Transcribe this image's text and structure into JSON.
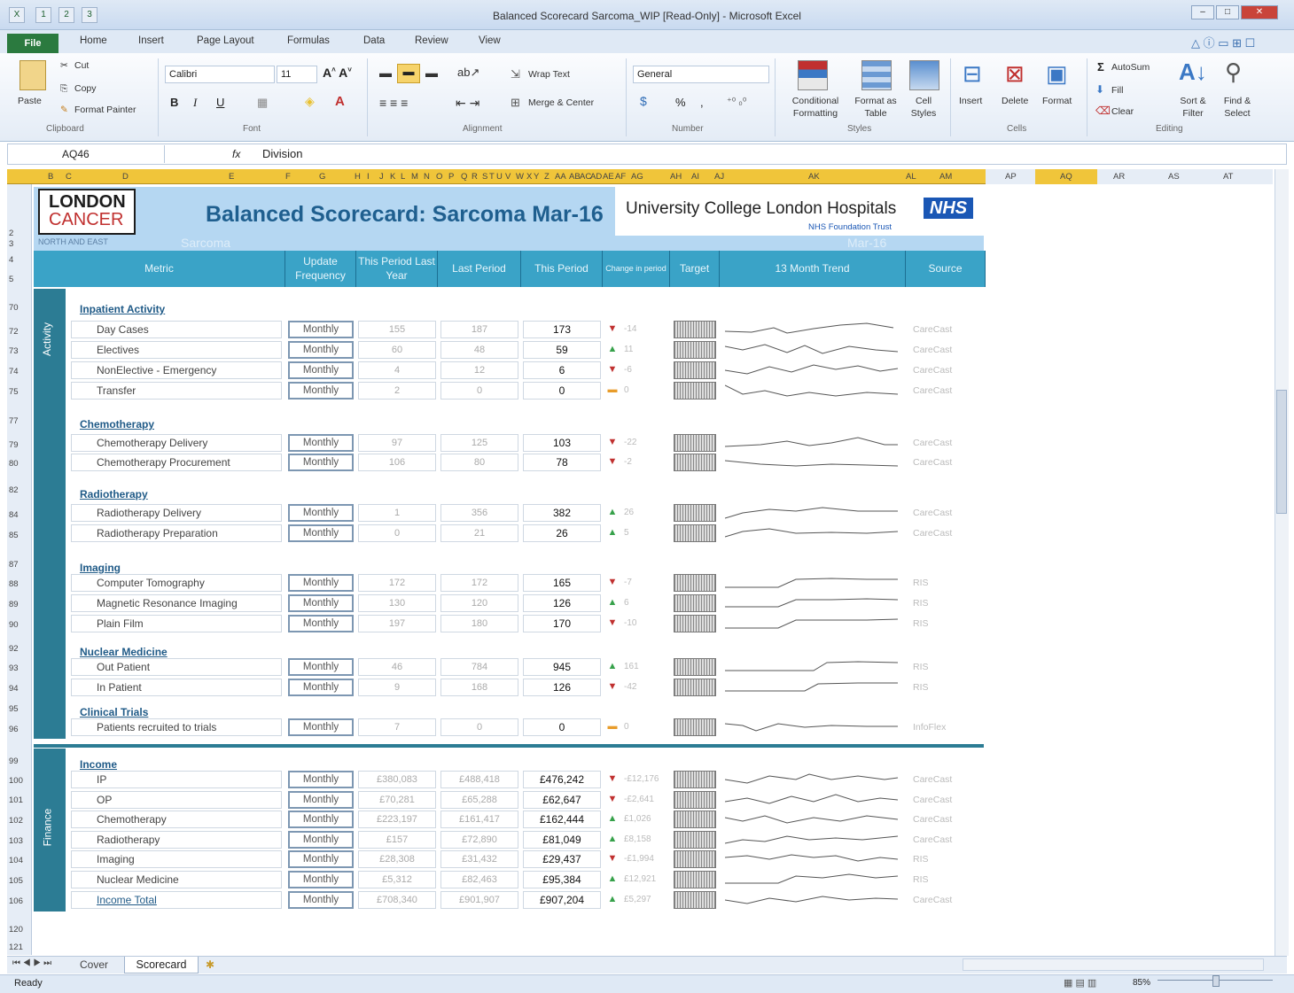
{
  "window": {
    "title": "Balanced Scorecard Sarcoma_WIP  [Read-Only]  -  Microsoft Excel",
    "qat": [
      "1",
      "2",
      "3"
    ],
    "min": "–",
    "max": "□",
    "close": "✕"
  },
  "ribbon_tabs": [
    {
      "label": "File",
      "key": "F"
    },
    {
      "label": "Home",
      "key": "H"
    },
    {
      "label": "Insert",
      "key": "N"
    },
    {
      "label": "Page Layout",
      "key": "P"
    },
    {
      "label": "Formulas",
      "key": "M"
    },
    {
      "label": "Data",
      "key": "A"
    },
    {
      "label": "Review",
      "key": "R"
    },
    {
      "label": "View",
      "key": "W"
    }
  ],
  "clipboard": {
    "paste": "Paste",
    "cut": "Cut",
    "copy": "Copy",
    "format_painter": "Format Painter",
    "group": "Clipboard"
  },
  "font": {
    "family": "Calibri",
    "size": "11",
    "bold": "B",
    "italic": "I",
    "underline": "U",
    "group": "Font"
  },
  "alignment": {
    "wrap": "Wrap Text",
    "merge": "Merge & Center",
    "group": "Alignment"
  },
  "number": {
    "format": "General",
    "percent": "%",
    "comma": ",",
    "group": "Number"
  },
  "styles": {
    "conditional": "Conditional Formatting",
    "format_table": "Format as Table",
    "cell_styles": "Cell Styles",
    "group": "Styles"
  },
  "cells": {
    "insert": "Insert",
    "delete": "Delete",
    "format": "Format",
    "group": "Cells"
  },
  "editing": {
    "autosum": "AutoSum",
    "fill": "Fill",
    "clear": "Clear",
    "sort": "Sort & Filter",
    "find": "Find & Select",
    "group": "Editing"
  },
  "formula_bar": {
    "name_box": "AQ46",
    "fx": "fx",
    "value": "Division"
  },
  "columns": [
    "B",
    "C",
    "D",
    "E",
    "F",
    "G",
    "H",
    "I",
    "J",
    "K",
    "L",
    "M",
    "N",
    "O",
    "P",
    "Q",
    "R",
    "S",
    "T",
    "U",
    "V",
    "W",
    "X",
    "Y",
    "Z",
    "AA",
    "AB",
    "AC",
    "AD",
    "AE",
    "AF",
    "AG",
    "AH",
    "AI",
    "AJ",
    "AK",
    "AL",
    "AM",
    "AP",
    "AQ",
    "AR",
    "AS",
    "AT"
  ],
  "header": {
    "logo_line1": "LONDON",
    "logo_line2": "CANCER",
    "logo_sub": "NORTH AND EAST",
    "title": "Balanced Scorecard: Sarcoma Mar-16",
    "ghost_sarcoma": "Sarcoma",
    "ghost_date": "Mar-16",
    "trust": "University College London Hospitals",
    "nhs": "NHS",
    "trust_sub": "NHS Foundation Trust"
  },
  "table_head": [
    "Metric",
    "Update Frequency",
    "This Period Last Year",
    "Last Period",
    "This Period",
    "Change in period",
    "Target",
    "13 Month Trend",
    "Source"
  ],
  "side_labels": {
    "activity": "Activity",
    "finance": "Finance"
  },
  "sections": [
    {
      "title": "Inpatient Activity",
      "rows": [
        {
          "metric": "Day Cases",
          "freq": "Monthly",
          "last_year": "155",
          "last_period": "187",
          "this_period": "173",
          "dir": "down",
          "chg": "-14",
          "src": "CareCast"
        },
        {
          "metric": "Electives",
          "freq": "Monthly",
          "last_year": "60",
          "last_period": "48",
          "this_period": "59",
          "dir": "up",
          "chg": "11",
          "src": "CareCast"
        },
        {
          "metric": "NonElective - Emergency",
          "freq": "Monthly",
          "last_year": "4",
          "last_period": "12",
          "this_period": "6",
          "dir": "down",
          "chg": "-6",
          "src": "CareCast"
        },
        {
          "metric": "Transfer",
          "freq": "Monthly",
          "last_year": "2",
          "last_period": "0",
          "this_period": "0",
          "dir": "flat",
          "chg": "0",
          "src": "CareCast"
        }
      ]
    },
    {
      "title": "Chemotherapy",
      "rows": [
        {
          "metric": "Chemotherapy Delivery",
          "freq": "Monthly",
          "last_year": "97",
          "last_period": "125",
          "this_period": "103",
          "dir": "down",
          "chg": "-22",
          "src": "CareCast"
        },
        {
          "metric": "Chemotherapy Procurement",
          "freq": "Monthly",
          "last_year": "106",
          "last_period": "80",
          "this_period": "78",
          "dir": "down",
          "chg": "-2",
          "src": "CareCast"
        }
      ]
    },
    {
      "title": "Radiotherapy",
      "rows": [
        {
          "metric": "Radiotherapy Delivery",
          "freq": "Monthly",
          "last_year": "1",
          "last_period": "356",
          "this_period": "382",
          "dir": "up",
          "chg": "26",
          "src": "CareCast"
        },
        {
          "metric": "Radiotherapy Preparation",
          "freq": "Monthly",
          "last_year": "0",
          "last_period": "21",
          "this_period": "26",
          "dir": "up",
          "chg": "5",
          "src": "CareCast"
        }
      ]
    },
    {
      "title": "Imaging",
      "rows": [
        {
          "metric": "Computer Tomography",
          "freq": "Monthly",
          "last_year": "172",
          "last_period": "172",
          "this_period": "165",
          "dir": "down",
          "chg": "-7",
          "src": "RIS"
        },
        {
          "metric": "Magnetic Resonance Imaging",
          "freq": "Monthly",
          "last_year": "130",
          "last_period": "120",
          "this_period": "126",
          "dir": "up",
          "chg": "6",
          "src": "RIS"
        },
        {
          "metric": "Plain Film",
          "freq": "Monthly",
          "last_year": "197",
          "last_period": "180",
          "this_period": "170",
          "dir": "down",
          "chg": "-10",
          "src": "RIS"
        }
      ]
    },
    {
      "title": "Nuclear Medicine",
      "rows": [
        {
          "metric": "Out Patient",
          "freq": "Monthly",
          "last_year": "46",
          "last_period": "784",
          "this_period": "945",
          "dir": "up",
          "chg": "161",
          "src": "RIS"
        },
        {
          "metric": "In Patient",
          "freq": "Monthly",
          "last_year": "9",
          "last_period": "168",
          "this_period": "126",
          "dir": "down",
          "chg": "-42",
          "src": "RIS"
        }
      ]
    },
    {
      "title": "Clinical Trials",
      "rows": [
        {
          "metric": "Patients recruited to trials",
          "freq": "Monthly",
          "last_year": "7",
          "last_period": "0",
          "this_period": "0",
          "dir": "flat",
          "chg": "0",
          "src": "InfoFlex"
        }
      ]
    },
    {
      "title": "Income",
      "rows": [
        {
          "metric": "IP",
          "freq": "Monthly",
          "last_year": "£380,083",
          "last_period": "£488,418",
          "this_period": "£476,242",
          "dir": "down",
          "chg": "-£12,176",
          "src": "CareCast"
        },
        {
          "metric": "OP",
          "freq": "Monthly",
          "last_year": "£70,281",
          "last_period": "£65,288",
          "this_period": "£62,647",
          "dir": "down",
          "chg": "-£2,641",
          "src": "CareCast"
        },
        {
          "metric": "Chemotherapy",
          "freq": "Monthly",
          "last_year": "£223,197",
          "last_period": "£161,417",
          "this_period": "£162,444",
          "dir": "up",
          "chg": "£1,026",
          "src": "CareCast"
        },
        {
          "metric": "Radiotherapy",
          "freq": "Monthly",
          "last_year": "£157",
          "last_period": "£72,890",
          "this_period": "£81,049",
          "dir": "up",
          "chg": "£8,158",
          "src": "CareCast"
        },
        {
          "metric": "Imaging",
          "freq": "Monthly",
          "last_year": "£28,308",
          "last_period": "£31,432",
          "this_period": "£29,437",
          "dir": "down",
          "chg": "-£1,994",
          "src": "RIS"
        },
        {
          "metric": "Nuclear Medicine",
          "freq": "Monthly",
          "last_year": "£5,312",
          "last_period": "£82,463",
          "this_period": "£95,384",
          "dir": "up",
          "chg": "£12,921",
          "src": "RIS"
        },
        {
          "metric": "Income Total",
          "freq": "Monthly",
          "last_year": "£708,340",
          "last_period": "£901,907",
          "this_period": "£907,204",
          "dir": "up",
          "chg": "£5,297",
          "src": "CareCast"
        }
      ]
    }
  ],
  "row_numbers": [
    "2",
    "3",
    "4",
    "5",
    "70",
    "72",
    "73",
    "74",
    "75",
    "77",
    "79",
    "80",
    "82",
    "84",
    "85",
    "87",
    "88",
    "89",
    "90",
    "92",
    "93",
    "94",
    "95",
    "96",
    "99",
    "100",
    "101",
    "102",
    "103",
    "104",
    "105",
    "106",
    "120",
    "121"
  ],
  "sheet_tabs": [
    "Cover",
    "Scorecard"
  ],
  "status": {
    "ready": "Ready",
    "zoom": "85%"
  }
}
